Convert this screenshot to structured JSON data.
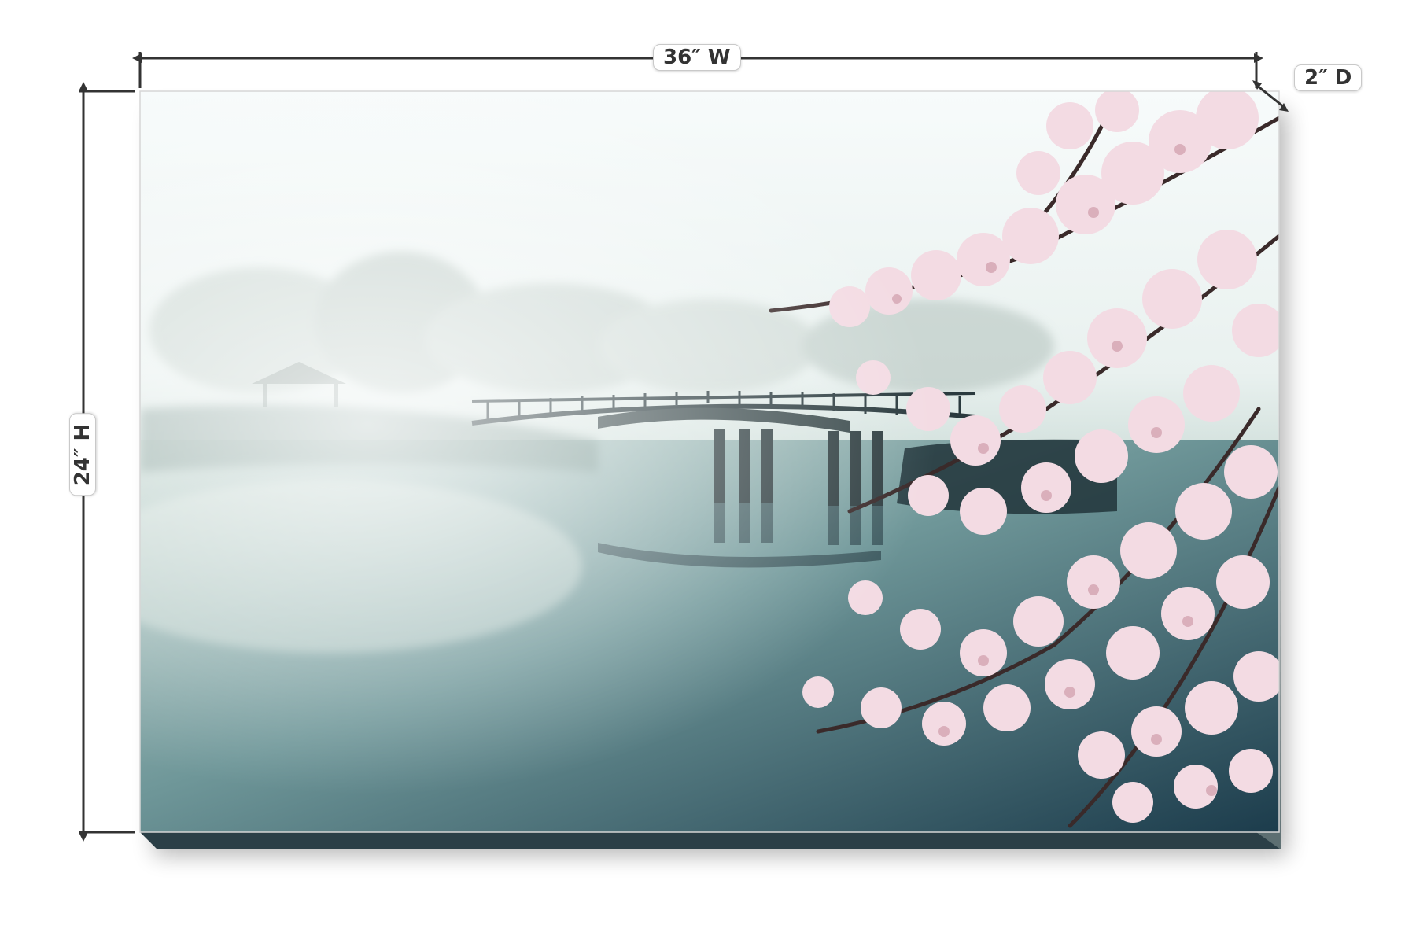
{
  "dimensions": {
    "width_label": "36″ W",
    "height_label": "24″ H",
    "depth_label": "2″ D"
  },
  "colors": {
    "dimension_line": "#333333",
    "label_border": "#c9c9c9",
    "canvas_edge": "#2b3f47"
  },
  "artwork": {
    "subject": "misty lake with arched wooden bridge and cherry blossom branches",
    "icons": [
      "bridge-icon",
      "cherry-blossom-icon"
    ]
  }
}
